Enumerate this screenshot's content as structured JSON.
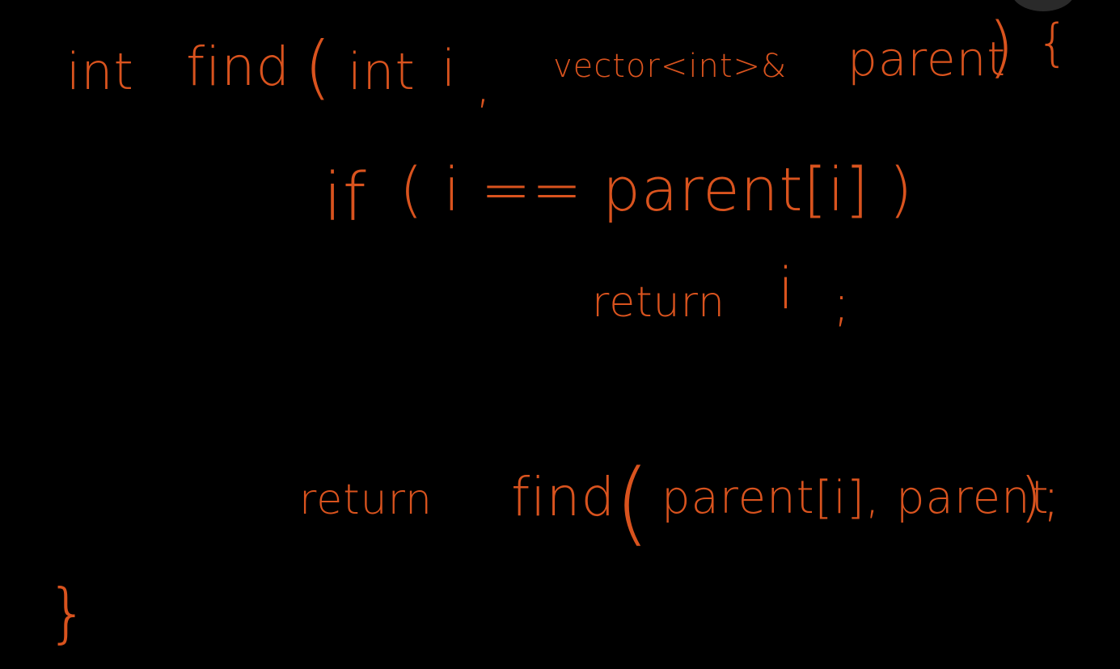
{
  "theme": {
    "background": "#000000",
    "ink_color": "#d9531e"
  },
  "code": {
    "signature": {
      "int_kw": "int",
      "fn_name": "find",
      "open_paren": "(",
      "param1_type": "int",
      "param1_name": "i",
      "comma": ",",
      "param2_type": "vector<int>&",
      "param2_name": "parent",
      "close_paren": ")",
      "open_brace": "{"
    },
    "if_line": {
      "if_kw": "if",
      "condition": "( i == parent[i] )"
    },
    "return_i": {
      "return_kw": "return",
      "value": "i",
      "semicolon": ";"
    },
    "return_find": {
      "return_kw": "return",
      "fn_name": "find",
      "open_paren": "(",
      "arg1": "parent[i],",
      "arg2": "parent",
      "close": ");"
    },
    "closing_brace": "}"
  }
}
